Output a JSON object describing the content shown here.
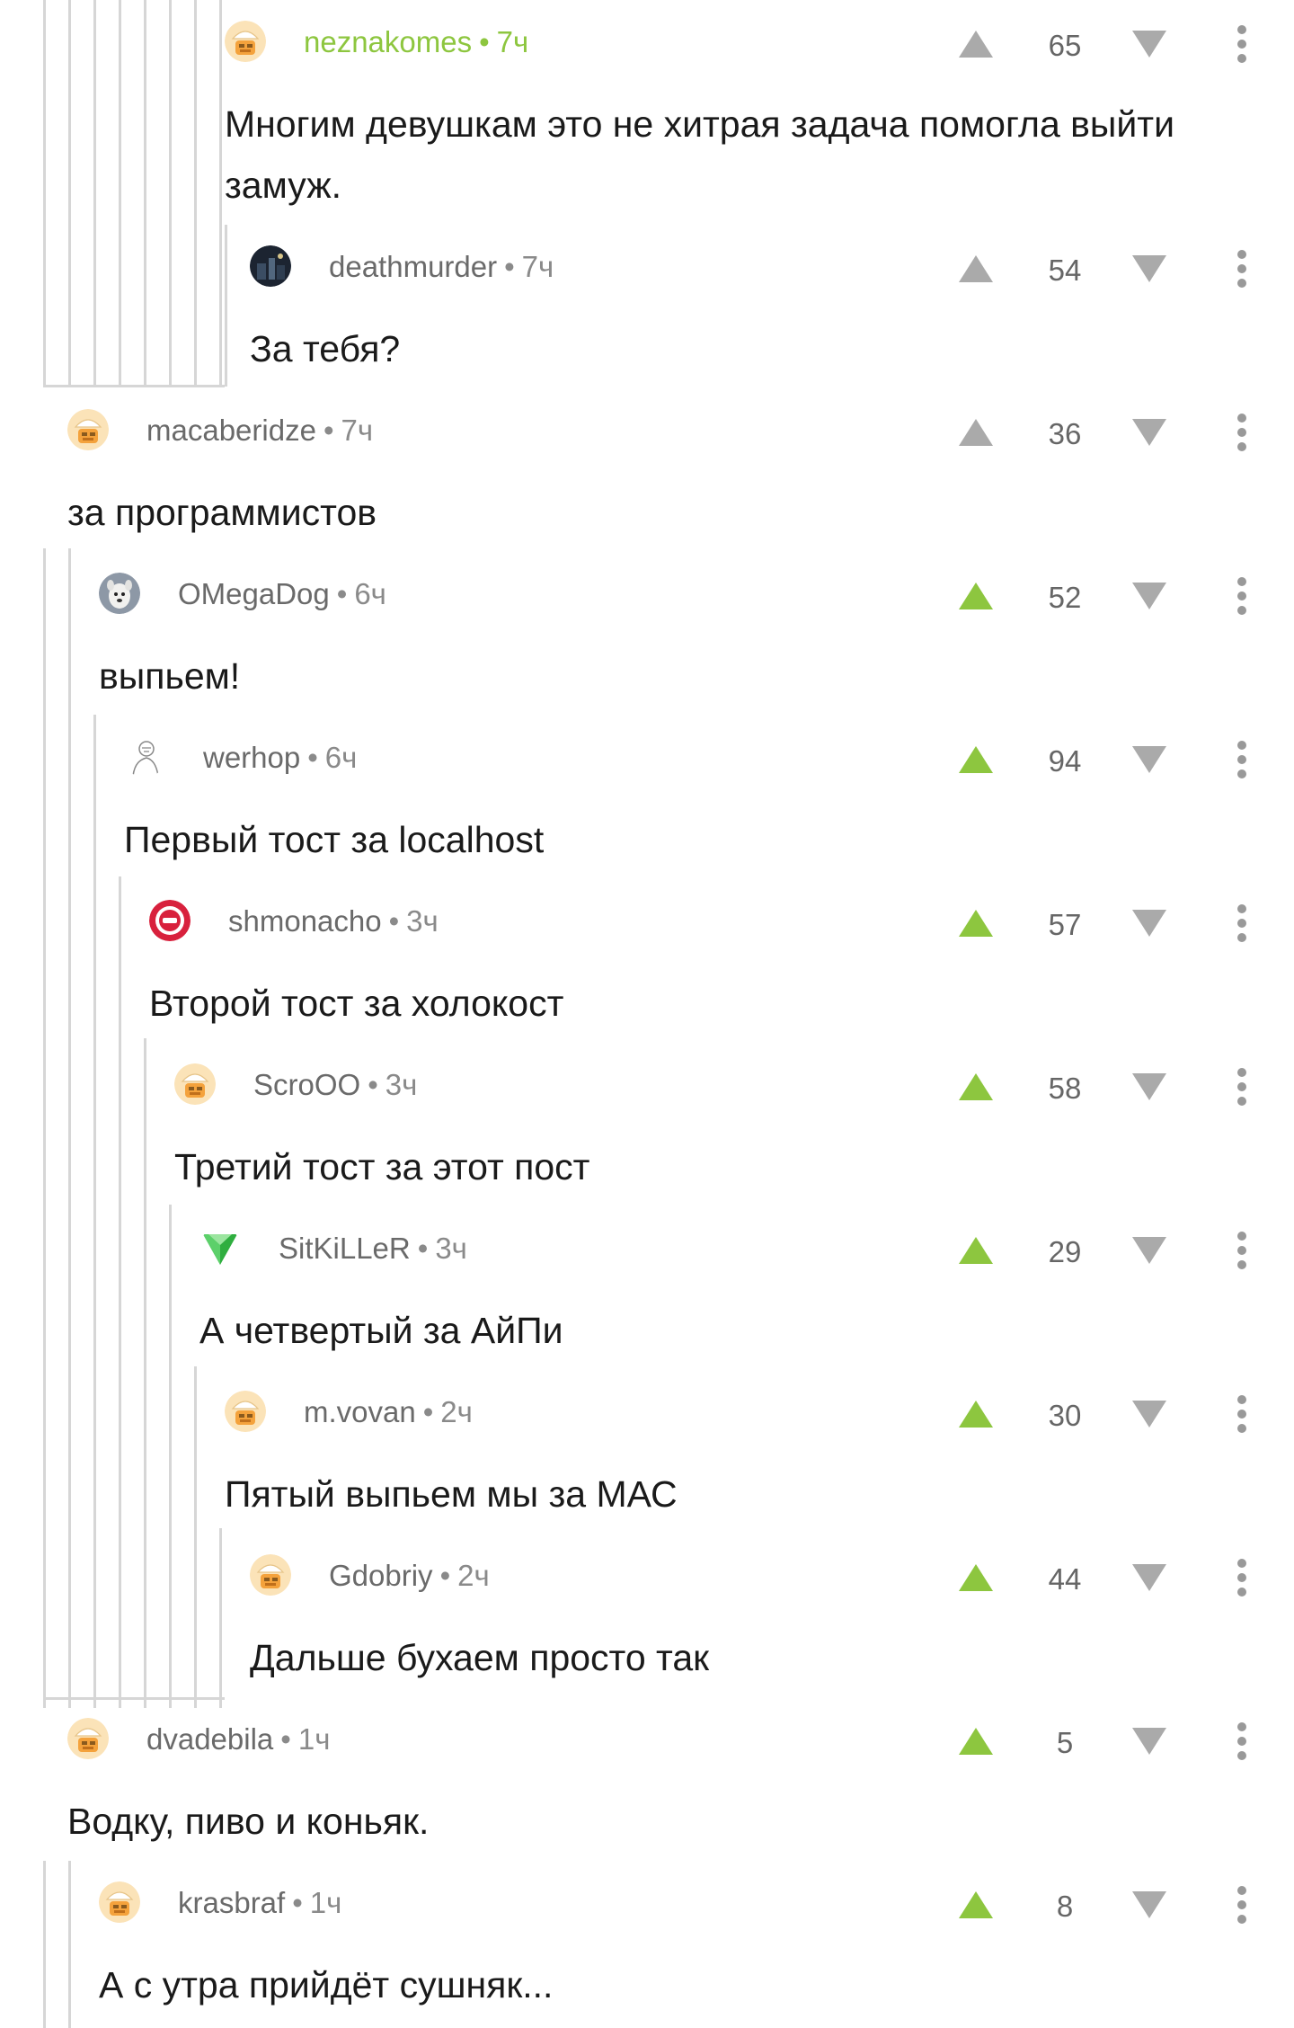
{
  "colors": {
    "accent_green": "#8dc63f",
    "vote_grey": "#aaaaaa",
    "thread_line": "#d6d6d6",
    "meta_text": "#6a6a6a",
    "body_text": "#1a1a1a"
  },
  "comments": [
    {
      "author": "neznakomes",
      "time": "7ч",
      "text": "Многим девушкам это не хитрая задача помогла выйти замуж.",
      "score": "65",
      "voted_up": false,
      "author_highlight": true,
      "avatar": "default-avatar"
    },
    {
      "author": "deathmurder",
      "time": "7ч",
      "text": "За тебя?",
      "score": "54",
      "voted_up": false,
      "author_highlight": false,
      "avatar": "dark-photo-avatar"
    },
    {
      "author": "macaberidze",
      "time": "7ч",
      "text": "за программистов",
      "score": "36",
      "voted_up": false,
      "author_highlight": false,
      "avatar": "default-avatar"
    },
    {
      "author": "OMegaDog",
      "time": "6ч",
      "text": "выпьем!",
      "score": "52",
      "voted_up": true,
      "author_highlight": false,
      "avatar": "dog-photo-avatar"
    },
    {
      "author": "werhop",
      "time": "6ч",
      "text": "Первый тост за localhost",
      "score": "94",
      "voted_up": true,
      "author_highlight": false,
      "avatar": "sketch-avatar"
    },
    {
      "author": "shmonacho",
      "time": "3ч",
      "text": "Второй тост за холокост",
      "score": "57",
      "voted_up": true,
      "author_highlight": false,
      "avatar": "red-badge-avatar"
    },
    {
      "author": "ScroOO",
      "time": "3ч",
      "text": "Третий тост за этот пост",
      "score": "58",
      "voted_up": true,
      "author_highlight": false,
      "avatar": "default-avatar"
    },
    {
      "author": "SitKiLLeR",
      "time": "3ч",
      "text": "А четвертый за АйПи",
      "score": "29",
      "voted_up": true,
      "author_highlight": false,
      "avatar": "green-gem-avatar"
    },
    {
      "author": "m.vovan",
      "time": "2ч",
      "text": "Пятый выпьем мы за МАС",
      "score": "30",
      "voted_up": true,
      "author_highlight": false,
      "avatar": "default-avatar"
    },
    {
      "author": "Gdobriy",
      "time": "2ч",
      "text": "Дальше бухаем просто так",
      "score": "44",
      "voted_up": true,
      "author_highlight": false,
      "avatar": "default-avatar"
    },
    {
      "author": "dvadebila",
      "time": "1ч",
      "text": "Водку, пиво и коньяк.",
      "score": "5",
      "voted_up": true,
      "author_highlight": false,
      "avatar": "default-avatar"
    },
    {
      "author": "krasbraf",
      "time": "1ч",
      "text": "А с утра прийдёт сушняк...",
      "score": "8",
      "voted_up": true,
      "author_highlight": false,
      "avatar": "default-avatar"
    }
  ]
}
